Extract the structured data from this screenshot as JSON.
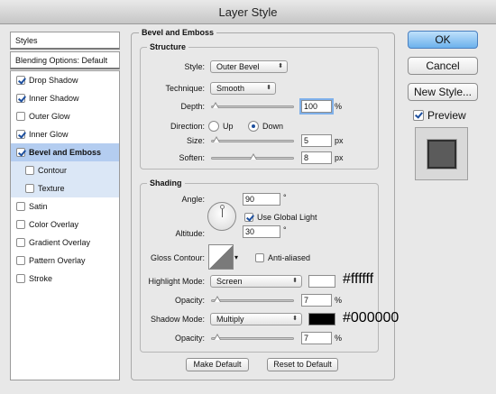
{
  "window": {
    "title": "Layer Style"
  },
  "left": {
    "header": "Styles",
    "blending": "Blending Options: Default",
    "items": [
      {
        "label": "Drop Shadow",
        "checked": true
      },
      {
        "label": "Inner Shadow",
        "checked": true
      },
      {
        "label": "Outer Glow",
        "checked": false
      },
      {
        "label": "Inner Glow",
        "checked": true
      },
      {
        "label": "Bevel and Emboss",
        "checked": true
      },
      {
        "label": "Contour",
        "checked": false
      },
      {
        "label": "Texture",
        "checked": false
      },
      {
        "label": "Satin",
        "checked": false
      },
      {
        "label": "Color Overlay",
        "checked": false
      },
      {
        "label": "Gradient Overlay",
        "checked": false
      },
      {
        "label": "Pattern Overlay",
        "checked": false
      },
      {
        "label": "Stroke",
        "checked": false
      }
    ]
  },
  "bevel": {
    "title": "Bevel and Emboss",
    "structure": {
      "title": "Structure",
      "style_label": "Style:",
      "style_value": "Outer Bevel",
      "technique_label": "Technique:",
      "technique_value": "Smooth",
      "depth_label": "Depth:",
      "depth_value": "100",
      "depth_unit": "%",
      "direction_label": "Direction:",
      "up_label": "Up",
      "down_label": "Down",
      "direction_value": "Down",
      "size_label": "Size:",
      "size_value": "5",
      "size_unit": "px",
      "soften_label": "Soften:",
      "soften_value": "8",
      "soften_unit": "px"
    },
    "shading": {
      "title": "Shading",
      "angle_label": "Angle:",
      "angle_value": "90",
      "angle_unit": "°",
      "use_global_label": "Use Global Light",
      "use_global_checked": true,
      "altitude_label": "Altitude:",
      "altitude_value": "30",
      "altitude_unit": "°",
      "gloss_label": "Gloss Contour:",
      "anti_aliased_label": "Anti-aliased",
      "anti_aliased_checked": false,
      "highlight_mode_label": "Highlight Mode:",
      "highlight_mode_value": "Screen",
      "highlight_color": "#ffffff",
      "highlight_hex": "#ffffff",
      "highlight_opacity_label": "Opacity:",
      "highlight_opacity_value": "7",
      "highlight_opacity_unit": "%",
      "shadow_mode_label": "Shadow Mode:",
      "shadow_mode_value": "Multiply",
      "shadow_color": "#000000",
      "shadow_hex": "#000000",
      "shadow_opacity_label": "Opacity:",
      "shadow_opacity_value": "7",
      "shadow_opacity_unit": "%"
    },
    "make_default": "Make Default",
    "reset_default": "Reset to Default"
  },
  "right": {
    "ok": "OK",
    "cancel": "Cancel",
    "new_style": "New Style...",
    "preview_label": "Preview",
    "preview_checked": true
  }
}
